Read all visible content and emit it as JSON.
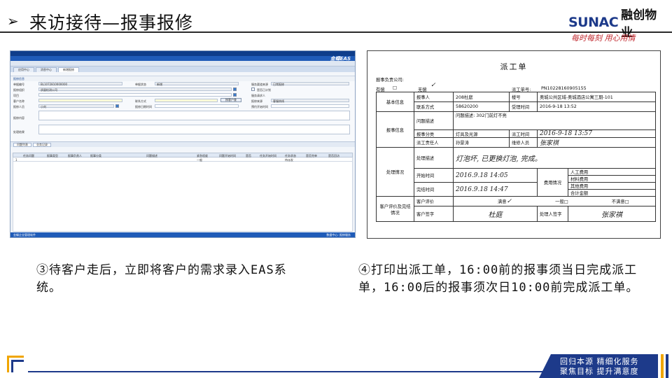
{
  "header": {
    "arrow": "➢",
    "title": "来访接待—报事报修",
    "logo_en": "SUNAC",
    "logo_cn": "融创物业",
    "slogan": "每时每刻 用心用情"
  },
  "eas": {
    "brand": "金蝶EAS",
    "tabs": [
      "应用中心",
      "消息中心",
      "新增报修"
    ],
    "section": "报修信息",
    "fields": {
      "f1": "单据编号",
      "f1v": "BL1072810000000",
      "f2": "单据状态",
      "f2v": "新增",
      "f3": "服务渠道来源",
      "f3v": "日常报修",
      "f4": "报修组织",
      "f4v": "质量检测公司",
      "f5": "是否已计划",
      "f6": "项目",
      "f7": "服务请求人",
      "f8": "客户名称",
      "f9": "联系方式",
      "f10": "按客户查",
      "f11": "报修来源",
      "f11v": "客服热线",
      "f12": "报修人员",
      "f12v": "小刘",
      "f13": "报修日期时间",
      "f14": "预约开始时间",
      "f15": "报修内容",
      "f16": "处理结果"
    },
    "grid_tabs": [
      "问题列表",
      "业务记录"
    ],
    "grid_cols": [
      "任务问题",
      "报事类型",
      "报事负责人",
      "报事分类",
      "问题描述",
      "紧急程度",
      "问题开始时间",
      "是否",
      "任务开始时间",
      "任务状态",
      "是否完单",
      "是否回访"
    ],
    "grid_row": [
      "1",
      "一般",
      "待派发"
    ],
    "status_left": "金蝶企业管理软件",
    "status_right": "数据中心: 报修服务"
  },
  "work_order": {
    "title": "派工单",
    "company_label": "报事负责公司:",
    "has_lbl": "有偿",
    "free_lbl": "无偿",
    "no_lbl": "派工单号:",
    "no_val": "PN10228160905155",
    "basic_info": "基本信息",
    "reporter_lbl": "报事人",
    "reporter_val": "208杜庭",
    "building_lbl": "楼号",
    "building_val": "奥城公共区域-奥城酒店公寓三期-101",
    "contact_lbl": "联系方式",
    "contact_val": "58620200",
    "accept_lbl": "受理时间",
    "accept_val": "2016-9-18 13:52",
    "report_info": "报事信息",
    "problem_lbl": "问题描述",
    "problem_val": "问题描述: 302门前灯不亮",
    "type_lbl": "报事分类",
    "type_val": "灯具及光源",
    "dispatch_time_lbl": "派工时间",
    "dispatch_time_val": "2016-9-18 13:57",
    "dispatcher_lbl": "派工责任人",
    "dispatcher_val": "孙景涛",
    "repairer_lbl": "维修人员",
    "repairer_val": "张家祺",
    "handling": "处理情况",
    "process_lbl": "处理描述",
    "process_val": "灯泡坏, 已更换灯泡, 完成。",
    "start_lbl": "开始时间",
    "start_val": "2016.9.18 14:05",
    "fee_lbl": "费用情况",
    "labor_lbl": "人工费用",
    "material_lbl": "材料费用",
    "other_lbl": "其他费用",
    "total_lbl": "合计金额",
    "finish_lbl": "完结时间",
    "finish_val": "2016.9.18 14:47",
    "eval_section": "客户评价及完结情况",
    "eval_lbl": "客户评价",
    "eval_a": "满意",
    "eval_b": "一般",
    "eval_c": "不满意",
    "sign_lbl": "客户签字",
    "sign_val": "杜庭",
    "worker_sign_lbl": "处理人签字",
    "worker_sign_val": "张家祺"
  },
  "captions": {
    "left": "③待客户走后，立即将客户的需求录入EAS系统。",
    "right": "④打印出派工单，16:00前的报事须当日完成派工单，16:00后的报事须次日10:00前完成派工单。"
  },
  "footer": {
    "line1": "回归本源 精细化服务",
    "line2": "聚焦目标 提升满意度"
  },
  "colors": {
    "brand_blue": "#1d3a8a",
    "accent_orange": "#f0a500",
    "slogan_red": "#c0262c"
  }
}
